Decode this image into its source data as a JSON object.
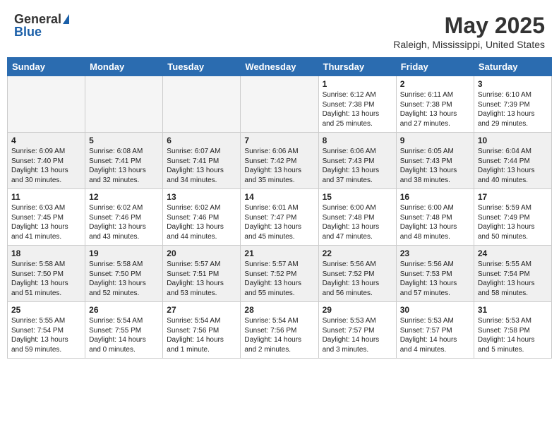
{
  "logo": {
    "general": "General",
    "blue": "Blue"
  },
  "title": "May 2025",
  "location": "Raleigh, Mississippi, United States",
  "days": [
    "Sunday",
    "Monday",
    "Tuesday",
    "Wednesday",
    "Thursday",
    "Friday",
    "Saturday"
  ],
  "weeks": [
    [
      {
        "day": "",
        "content": ""
      },
      {
        "day": "",
        "content": ""
      },
      {
        "day": "",
        "content": ""
      },
      {
        "day": "",
        "content": ""
      },
      {
        "day": "1",
        "content": "Sunrise: 6:12 AM\nSunset: 7:38 PM\nDaylight: 13 hours and 25 minutes."
      },
      {
        "day": "2",
        "content": "Sunrise: 6:11 AM\nSunset: 7:38 PM\nDaylight: 13 hours and 27 minutes."
      },
      {
        "day": "3",
        "content": "Sunrise: 6:10 AM\nSunset: 7:39 PM\nDaylight: 13 hours and 29 minutes."
      }
    ],
    [
      {
        "day": "4",
        "content": "Sunrise: 6:09 AM\nSunset: 7:40 PM\nDaylight: 13 hours and 30 minutes."
      },
      {
        "day": "5",
        "content": "Sunrise: 6:08 AM\nSunset: 7:41 PM\nDaylight: 13 hours and 32 minutes."
      },
      {
        "day": "6",
        "content": "Sunrise: 6:07 AM\nSunset: 7:41 PM\nDaylight: 13 hours and 34 minutes."
      },
      {
        "day": "7",
        "content": "Sunrise: 6:06 AM\nSunset: 7:42 PM\nDaylight: 13 hours and 35 minutes."
      },
      {
        "day": "8",
        "content": "Sunrise: 6:06 AM\nSunset: 7:43 PM\nDaylight: 13 hours and 37 minutes."
      },
      {
        "day": "9",
        "content": "Sunrise: 6:05 AM\nSunset: 7:43 PM\nDaylight: 13 hours and 38 minutes."
      },
      {
        "day": "10",
        "content": "Sunrise: 6:04 AM\nSunset: 7:44 PM\nDaylight: 13 hours and 40 minutes."
      }
    ],
    [
      {
        "day": "11",
        "content": "Sunrise: 6:03 AM\nSunset: 7:45 PM\nDaylight: 13 hours and 41 minutes."
      },
      {
        "day": "12",
        "content": "Sunrise: 6:02 AM\nSunset: 7:46 PM\nDaylight: 13 hours and 43 minutes."
      },
      {
        "day": "13",
        "content": "Sunrise: 6:02 AM\nSunset: 7:46 PM\nDaylight: 13 hours and 44 minutes."
      },
      {
        "day": "14",
        "content": "Sunrise: 6:01 AM\nSunset: 7:47 PM\nDaylight: 13 hours and 45 minutes."
      },
      {
        "day": "15",
        "content": "Sunrise: 6:00 AM\nSunset: 7:48 PM\nDaylight: 13 hours and 47 minutes."
      },
      {
        "day": "16",
        "content": "Sunrise: 6:00 AM\nSunset: 7:48 PM\nDaylight: 13 hours and 48 minutes."
      },
      {
        "day": "17",
        "content": "Sunrise: 5:59 AM\nSunset: 7:49 PM\nDaylight: 13 hours and 50 minutes."
      }
    ],
    [
      {
        "day": "18",
        "content": "Sunrise: 5:58 AM\nSunset: 7:50 PM\nDaylight: 13 hours and 51 minutes."
      },
      {
        "day": "19",
        "content": "Sunrise: 5:58 AM\nSunset: 7:50 PM\nDaylight: 13 hours and 52 minutes."
      },
      {
        "day": "20",
        "content": "Sunrise: 5:57 AM\nSunset: 7:51 PM\nDaylight: 13 hours and 53 minutes."
      },
      {
        "day": "21",
        "content": "Sunrise: 5:57 AM\nSunset: 7:52 PM\nDaylight: 13 hours and 55 minutes."
      },
      {
        "day": "22",
        "content": "Sunrise: 5:56 AM\nSunset: 7:52 PM\nDaylight: 13 hours and 56 minutes."
      },
      {
        "day": "23",
        "content": "Sunrise: 5:56 AM\nSunset: 7:53 PM\nDaylight: 13 hours and 57 minutes."
      },
      {
        "day": "24",
        "content": "Sunrise: 5:55 AM\nSunset: 7:54 PM\nDaylight: 13 hours and 58 minutes."
      }
    ],
    [
      {
        "day": "25",
        "content": "Sunrise: 5:55 AM\nSunset: 7:54 PM\nDaylight: 13 hours and 59 minutes."
      },
      {
        "day": "26",
        "content": "Sunrise: 5:54 AM\nSunset: 7:55 PM\nDaylight: 14 hours and 0 minutes."
      },
      {
        "day": "27",
        "content": "Sunrise: 5:54 AM\nSunset: 7:56 PM\nDaylight: 14 hours and 1 minute."
      },
      {
        "day": "28",
        "content": "Sunrise: 5:54 AM\nSunset: 7:56 PM\nDaylight: 14 hours and 2 minutes."
      },
      {
        "day": "29",
        "content": "Sunrise: 5:53 AM\nSunset: 7:57 PM\nDaylight: 14 hours and 3 minutes."
      },
      {
        "day": "30",
        "content": "Sunrise: 5:53 AM\nSunset: 7:57 PM\nDaylight: 14 hours and 4 minutes."
      },
      {
        "day": "31",
        "content": "Sunrise: 5:53 AM\nSunset: 7:58 PM\nDaylight: 14 hours and 5 minutes."
      }
    ]
  ]
}
